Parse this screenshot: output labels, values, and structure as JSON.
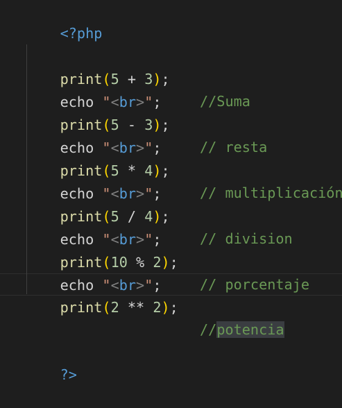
{
  "code": {
    "open_tag": "<?php",
    "close_tag": "?>",
    "echo_line": {
      "keyword": "echo",
      "quote_open": "\"",
      "lt": "<",
      "tag": "br",
      "gt": ">",
      "quote_close": "\"",
      "semi": ";"
    },
    "print_lines": [
      {
        "fn": "print",
        "a": "5",
        "op": "+",
        "b": "3",
        "comment": "//Suma"
      },
      {
        "fn": "print",
        "a": "5",
        "op": "-",
        "b": "3",
        "comment": "// resta"
      },
      {
        "fn": "print",
        "a": "5",
        "op": "*",
        "b": "4",
        "comment": "// multiplicación"
      },
      {
        "fn": "print",
        "a": "5",
        "op": "/",
        "b": "4",
        "comment": "// division"
      },
      {
        "fn": "print",
        "a": "10",
        "op": "%",
        "b": "2",
        "comment": "// porcentaje"
      },
      {
        "fn": "print",
        "a": "2",
        "op": "**",
        "b": "2",
        "comment_prefix": "//",
        "comment_selected": "potencia"
      }
    ]
  },
  "colors": {
    "background": "#1e1e1e",
    "keyword_tag": "#569cd6",
    "function": "#dcdcaa",
    "bracket": "#ffd700",
    "number": "#b5cea8",
    "string": "#ce9178",
    "comment": "#6a9955",
    "selection": "#3a3d41"
  }
}
